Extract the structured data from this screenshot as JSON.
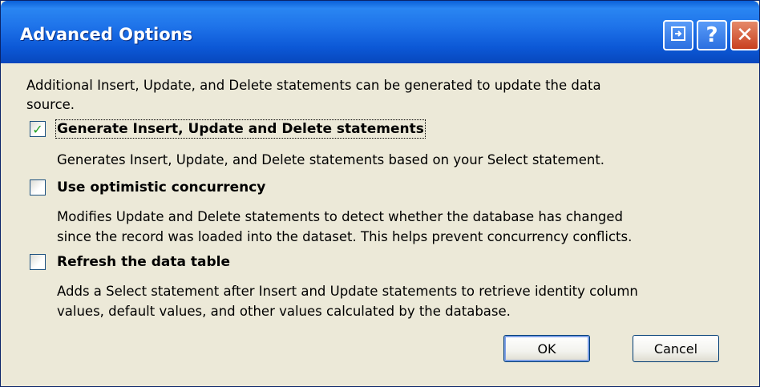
{
  "window": {
    "title": "Advanced Options",
    "buttons": {
      "context_help_icon": "context-help-icon",
      "help_label": "?",
      "close_label": "✕"
    }
  },
  "intro": {
    "line1": "Additional  Insert, Update, and Delete statements can be generated to update the data",
    "line2": "source."
  },
  "options": [
    {
      "label": "Generate Insert, Update and Delete statements",
      "checked": true,
      "description": [
        "Generates Insert, Update, and Delete statements based on your Select statement."
      ]
    },
    {
      "label": "Use optimistic concurrency",
      "checked": false,
      "description": [
        "Modifies Update and Delete statements to detect whether the database has changed",
        "since the record was loaded into the dataset. This helps prevent concurrency conflicts."
      ]
    },
    {
      "label": "Refresh the data table",
      "checked": false,
      "description": [
        "Adds a Select statement after Insert and Update statements to retrieve identity column",
        "values, default values, and other values calculated by the database."
      ]
    }
  ],
  "buttons": {
    "ok": "OK",
    "cancel": "Cancel"
  },
  "colors": {
    "titlebar": "#0c58d6",
    "dialog_background": "#ece9d8",
    "checkmark": "#21a121"
  }
}
